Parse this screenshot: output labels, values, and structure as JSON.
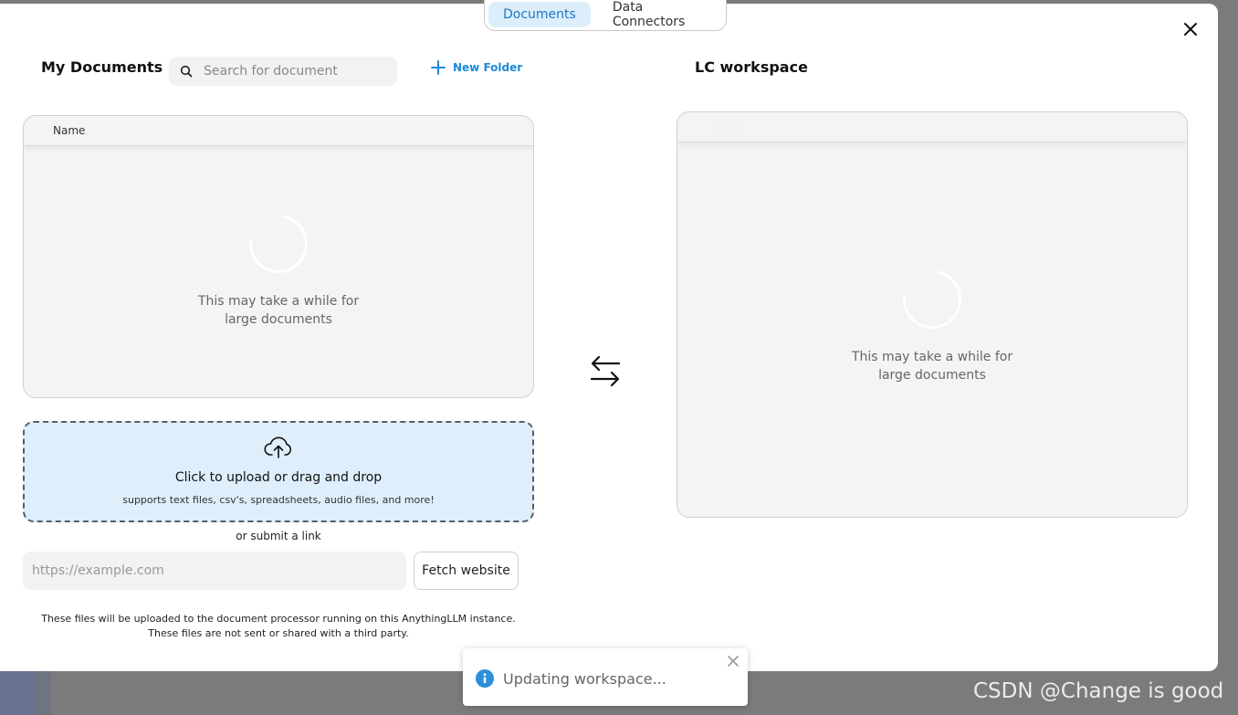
{
  "tabs": [
    {
      "label": "Documents",
      "active": true
    },
    {
      "label": "Data Connectors",
      "active": false
    }
  ],
  "left": {
    "title": "My Documents",
    "search_placeholder": "Search for document",
    "new_folder_label": "New Folder",
    "column_header": "Name",
    "loading_text_line1": "This may take a while for",
    "loading_text_line2": "large documents"
  },
  "right": {
    "title": "LC workspace",
    "column_header": "Name",
    "loading_text_line1": "This may take a while for",
    "loading_text_line2": "large documents"
  },
  "upload": {
    "main_text": "Click to upload or drag and drop",
    "sub_text": "supports text files, csv's, spreadsheets, audio files, and more!",
    "or_link_text": "or submit a link",
    "url_placeholder": "https://example.com",
    "fetch_label": "Fetch website",
    "disclaimer_line1": "These files will be uploaded to the document processor running on this AnythingLLM instance.",
    "disclaimer_line2": "These files are not sent or shared with a third party."
  },
  "toast": {
    "message": "Updating workspace..."
  },
  "watermark": "CSDN @Change is good",
  "colors": {
    "accent": "#1c8bd9",
    "tab_active_bg": "#dceefa",
    "upload_bg": "#deeefb",
    "info_blue": "#2e8fd9"
  }
}
